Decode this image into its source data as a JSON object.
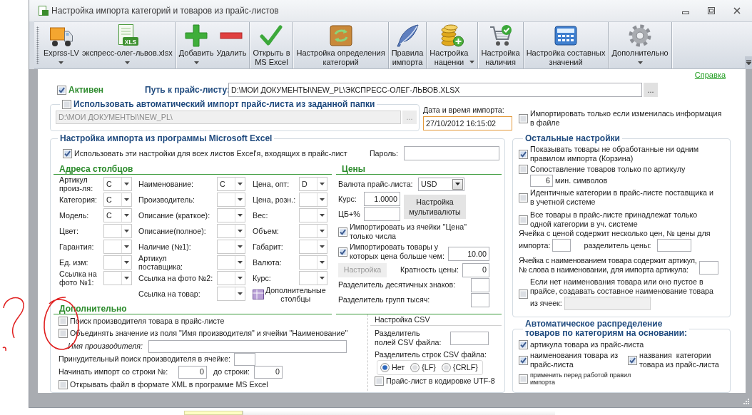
{
  "window": {
    "title": "Настройка импорта категорий и товаров из прайс-листов"
  },
  "toolbar": [
    {
      "buttons": [
        {
          "label": "Exprss-LV",
          "dropdown": true
        },
        {
          "label": "экспресс-олег-львов.xlsx",
          "dropdown": true,
          "icon_badge": "XLS"
        }
      ]
    },
    {
      "buttons": [
        {
          "label": "Добавить",
          "dropdown": true
        },
        {
          "label": "Удалить",
          "dropdown": false
        }
      ]
    },
    {
      "buttons": [
        {
          "label": "Открыть в\nMS Excel",
          "dropdown": false
        }
      ]
    },
    {
      "buttons": [
        {
          "label": "Настройка определения\nкатегорий",
          "dropdown": false
        }
      ]
    },
    {
      "buttons": [
        {
          "label": "Правила\nимпорта",
          "dropdown": false
        }
      ]
    },
    {
      "buttons": [
        {
          "label": "Настройка\nнаценки",
          "dropdown": true
        }
      ]
    },
    {
      "buttons": [
        {
          "label": "Настройка\nналичия",
          "dropdown": false
        }
      ]
    },
    {
      "buttons": [
        {
          "label": "Настройка составных\nзначений",
          "dropdown": false
        }
      ]
    },
    {
      "buttons": [
        {
          "label": "Дополнительно",
          "dropdown": true
        }
      ]
    }
  ],
  "help_link": "Справка",
  "active": {
    "label": "Активен",
    "checked": true
  },
  "price_list_path": {
    "label": "Путь к прайс-листу:",
    "value": "D:\\МОИ ДОКУМЕНТЫ\\NEW_PL\\ЭКСПРЕСС-ОЛЕГ-ЛЬВОВ.XLSX",
    "browse_button": "..."
  },
  "auto_import": {
    "label": "Использовать автоматический импорт прайс-листа из заданной папки",
    "checked": false,
    "folder": "D:\\МОИ ДОКУМЕНТЫ\\NEW_PL\\",
    "disabled": true,
    "browse_button": "..."
  },
  "import_date": {
    "label": "Дата и время импорта:",
    "value": "27/10/2012 16:15:02",
    "highlighted": true
  },
  "only_if_changed": {
    "label": "Импортировать только если изменилась информация\nв файле",
    "checked": false
  },
  "excel_import": {
    "title": "Настройка импорта из программы Microsoft Excel",
    "all_sheets": {
      "label": "Использовать эти настройки для всех листов Excel'я, входящих в прайс-лист",
      "checked": true
    },
    "password": {
      "label": "Пароль:"
    },
    "column_addresses": {
      "title": "Адреса столбцов",
      "columns": [
        {
          "fields": [
            {
              "label": "Артикул\nпроиз-ля:",
              "value": "C"
            },
            {
              "label": "Категория:",
              "value": "C"
            },
            {
              "label": "Модель:",
              "value": "C"
            },
            {
              "label": "Цвет:"
            },
            {
              "label": "Гарантия:"
            },
            {
              "label": "Ед. изм:"
            },
            {
              "label": "Ссылка на\nфото №1:"
            }
          ]
        },
        {
          "fields": [
            {
              "label": "Наименование:",
              "value": "C"
            },
            {
              "label": "Производитель:"
            },
            {
              "label": "Описание (краткое):"
            },
            {
              "label": "Описание(полное):"
            },
            {
              "label": "Наличие (№1):"
            },
            {
              "label": "Артикул\nпоставщика:"
            },
            {
              "label": "Ссылка на фото №2:"
            },
            {
              "label": "Ссылка на товар:"
            }
          ]
        },
        {
          "fields": [
            {
              "label": "Цена, опт:",
              "value": "D"
            },
            {
              "label": "Цена, розн.:"
            },
            {
              "label": "Вес:"
            },
            {
              "label": "Объем:"
            },
            {
              "label": "Габарит:"
            },
            {
              "label": "Валюта:"
            },
            {
              "label": "Курс:"
            }
          ]
        }
      ],
      "more_columns_button": "Дополнительные\nстолбцы"
    },
    "prices": {
      "title": "Цены",
      "currency": {
        "label": "Валюта прайс-листа:",
        "value": "USD"
      },
      "rate": {
        "label": "Курс:",
        "value": "1.0000"
      },
      "cb_percent": {
        "label": "ЦБ+%"
      },
      "multicurrency_button": "Настройка\nмультивалюты",
      "numbers_only": {
        "label": "Импортировать из ячейки \"Цена\"\nтолько числа",
        "checked": true
      },
      "min_price": {
        "label": "Импортировать товары у\nкоторых цена больше чем:",
        "checked": true,
        "value": "10.00"
      },
      "settings_button": {
        "label": "Настройка",
        "disabled": true
      },
      "price_multiple": {
        "label": "Кратность цены:",
        "value": "0"
      },
      "decimal_separator": {
        "label": "Разделитель десятичных знаков:"
      },
      "thousands_separator": {
        "label": "Разделитель групп тысяч:"
      }
    },
    "additional": {
      "title": "Дополнительно",
      "find_manufacturer": {
        "label": "Поиск производителя товара в прайс-листе",
        "checked": false
      },
      "merge_names": {
        "label": "Объединять значение из поля \"Имя производителя\" и ячейки \"Наименование\"",
        "checked": false
      },
      "manufacturer_name": {
        "label": "Имя производителя:"
      },
      "forced_search": {
        "label": "Принудительный поиск производителя в ячейке:"
      },
      "start_row": {
        "label": "Начинать импорт со строки №:",
        "value": "0"
      },
      "end_row": {
        "label": "до строки:",
        "value": "0"
      },
      "open_xml": {
        "label": "Открывать файл в формате XML в программе MS Excel",
        "checked": false
      }
    },
    "csv": {
      "title": "Настройка CSV",
      "field_separator": {
        "label": "Разделитель\nполей CSV файла:"
      },
      "row_separator": {
        "label": "Разделитель строк CSV файла:",
        "options": [
          {
            "label": "Нет",
            "selected": true
          },
          {
            "label": "{LF}",
            "selected": false
          },
          {
            "label": "{CRLF}",
            "selected": false
          }
        ]
      },
      "utf8": {
        "label": "Прайс-лист в кодировке UTF-8",
        "checked": false
      }
    }
  },
  "other_settings": {
    "title": "Остальные настройки",
    "show_unprocessed": {
      "label": "Показывать товары не обработанные ни одним\nправилом импорта (Корзина)",
      "checked": true
    },
    "match_by_article": {
      "label": "Сопоставление товаров только по артикулу",
      "checked": false
    },
    "min_chars": {
      "value": "6",
      "label": "мин. символов"
    },
    "identical_categories": {
      "label": "Идентичные категории в прайс-листе поставщика и\nв учетной системе",
      "checked": false
    },
    "single_category": {
      "label": "Все товары в прайс-листе принадлежат только\nодной категории в уч. системе",
      "checked": false
    },
    "multiple_prices": {
      "label": "Ячейка с ценой содержит несколько цен, № цены для",
      "label_continued": "импорта:",
      "separator_label": "разделитель цены:"
    },
    "article_in_name": {
      "label": "Ячейка с наименованием товара содержит артикул,\n№ слова в наименовании, для импорта артикула:"
    },
    "compose_name": {
      "label": "Если нет наименования товара или оно пустое в\nпрайсе, создавать составное наименование товара",
      "label_continued": "из ячеек:",
      "checked": false,
      "field_disabled": true
    }
  },
  "auto_distribution": {
    "title": "Автоматическое распределение\nтоваров по категориям на основании:",
    "by_article": {
      "label": "артикула товара из прайс-листа",
      "checked": true
    },
    "by_name": {
      "label": "наименования товара из\nпрайс-листа",
      "checked": true
    },
    "by_category": {
      "label": "названия  категории\nтовара из прайс-листа",
      "checked": true
    },
    "before_rules": {
      "label": "применить перед работой правил\nимпорта",
      "checked": false
    }
  }
}
